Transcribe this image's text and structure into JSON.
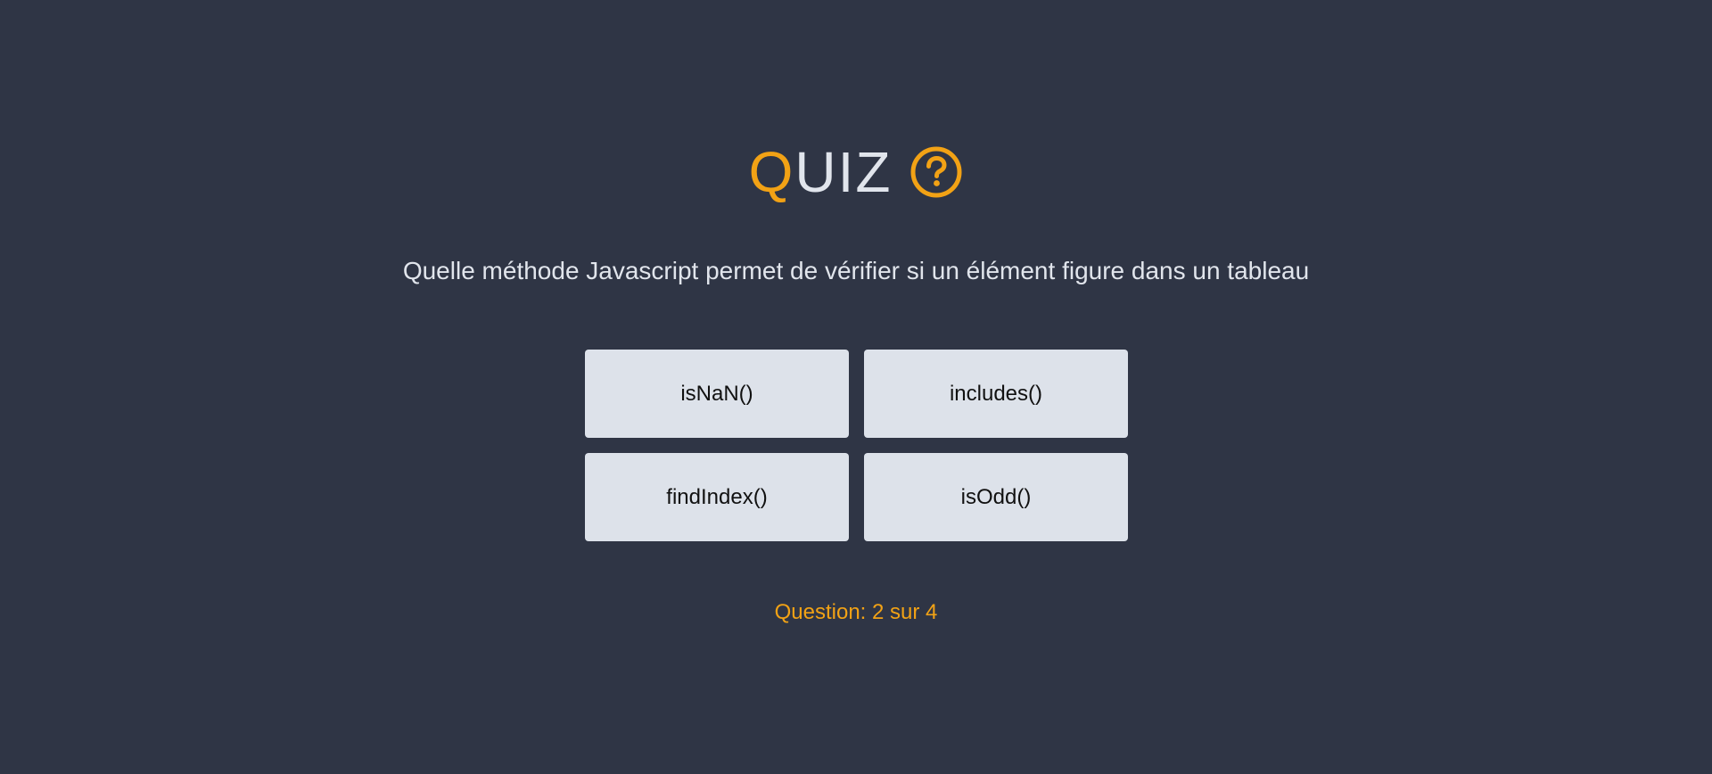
{
  "colors": {
    "background": "#2f3545",
    "accent": "#f2a215",
    "text": "#e1e5ec",
    "button_bg": "#dde2ea",
    "button_text": "#111111"
  },
  "title": {
    "accent_letter": "Q",
    "rest": "UIZ",
    "icon": "question-circle-icon"
  },
  "question": {
    "text": "Quelle méthode Javascript permet de vérifier si un élément figure dans un tableau"
  },
  "answers": [
    {
      "label": "isNaN()"
    },
    {
      "label": "includes()"
    },
    {
      "label": "findIndex()"
    },
    {
      "label": "isOdd()"
    }
  ],
  "progress": {
    "text": "Question: 2 sur 4"
  }
}
